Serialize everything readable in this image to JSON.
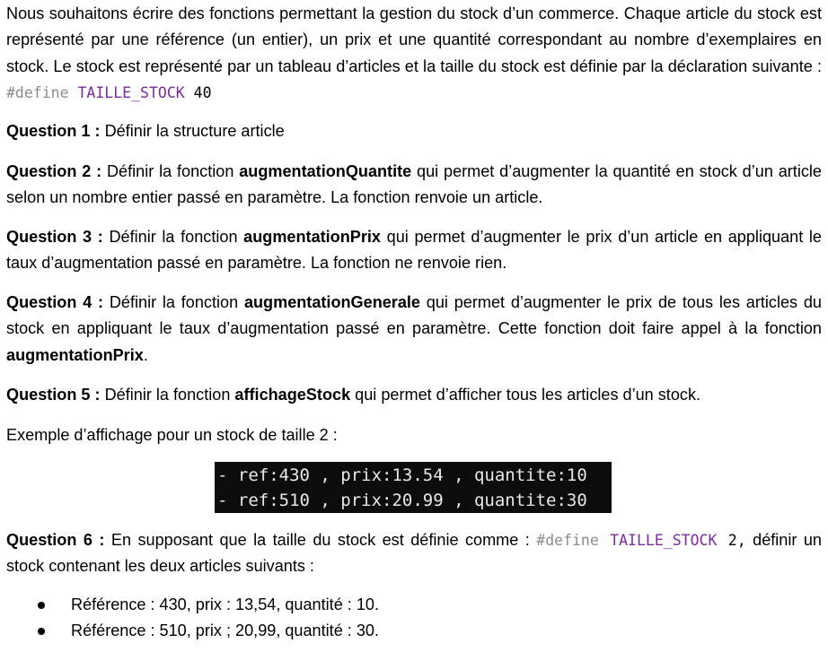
{
  "intro": {
    "text": "Nous souhaitons écrire des fonctions permettant la gestion du stock d’un commerce. Chaque article du stock est représenté par une référence (un entier), un prix et une quantité correspondant au nombre d’exemplaires en stock. Le stock est représenté par un tableau d’articles et la taille du stock est définie par la déclaration suivante : ",
    "code": {
      "keyword": "#define",
      "macro": "TAILLE_STOCK",
      "value": "40"
    }
  },
  "questions": [
    {
      "label": "Question 1 :",
      "parts": [
        "Définir la structure article"
      ]
    },
    {
      "label": "Question 2 :",
      "before": "Définir la fonction ",
      "fn": "augmentationQuantite",
      "after": " qui permet d’augmenter la quantité en stock d’un article selon un nombre entier passé en paramètre. La fonction renvoie un article."
    },
    {
      "label": "Question 3 :",
      "before": "Définir la fonction ",
      "fn": "augmentationPrix",
      "after": " qui permet d’augmenter le prix d’un article en appliquant le taux d’augmentation passé en paramètre. La fonction ne renvoie rien."
    },
    {
      "label": "Question 4 :",
      "before": "Définir la fonction ",
      "fn": "augmentationGenerale",
      "middle": " qui permet d’augmenter le prix de tous les articles du stock en appliquant le taux d’augmentation passé en paramètre. Cette fonction doit faire appel à la fonction ",
      "fn2": "augmentationPrix",
      "after": "."
    },
    {
      "label": "Question 5 :",
      "before": "Définir la fonction ",
      "fn": "affichageStock",
      "after": " qui permet d’afficher tous les articles d’un stock."
    },
    {
      "label": "Question 6 :",
      "before": "En supposant que la taille du stock est définie comme : ",
      "code": {
        "keyword": "#define",
        "macro": "TAILLE_STOCK",
        "value": "2,"
      },
      "after": "définir un stock contenant les deux articles suivants :"
    }
  ],
  "example_label": "Exemple d’affichage pour un stock de taille 2 :",
  "terminal_lines": [
    "- ref:430 , prix:13.54 , quantite:10",
    "- ref:510 , prix:20.99 , quantite:30"
  ],
  "bullets": [
    "Référence : 430, prix : 13,54, quantité : 10.",
    "Référence : 510, prix ; 20,99, quantité : 30."
  ]
}
